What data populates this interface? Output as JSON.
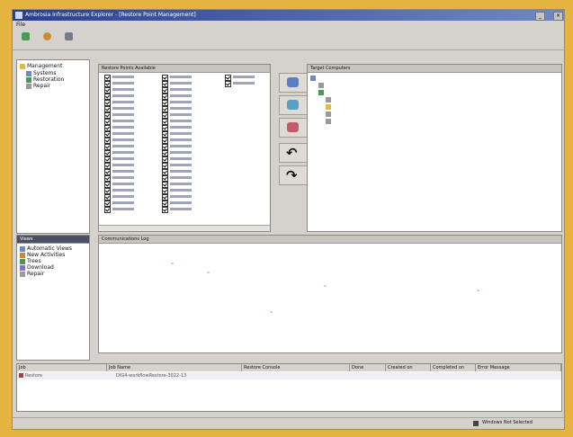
{
  "window": {
    "title": "Ambrosia Infrastructure Explorer - [Restore Point Management]",
    "minimize": "_",
    "maximize": "□",
    "close": "×"
  },
  "menu": {
    "file": "File"
  },
  "toolbar": {
    "buttons": [
      {
        "icon": "recycle-icon",
        "label": ""
      },
      {
        "icon": "person-icon",
        "label": ""
      },
      {
        "icon": "wrench-icon",
        "label": ""
      }
    ]
  },
  "nav_tree": {
    "items": [
      "Management",
      "Systems",
      "Restoration",
      "Repair"
    ]
  },
  "views": {
    "header": "Views",
    "items": [
      "Automatic Views",
      "New Activities",
      "Trees",
      "Download",
      "Repair"
    ]
  },
  "point_list": {
    "header": "Restore Points Available"
  },
  "target": {
    "header": "Target Computers"
  },
  "log": {
    "header": "Communications Log"
  },
  "jobs": {
    "columns": [
      "Job",
      "Job Name",
      "Restore Console",
      "Done",
      "Created on",
      "Completed on",
      "Error Message"
    ],
    "rows": [
      {
        "job": "Restore",
        "name": "DIG4-workflowRestore-3022-13"
      }
    ]
  },
  "status": {
    "text": "Windows Not Selected"
  }
}
